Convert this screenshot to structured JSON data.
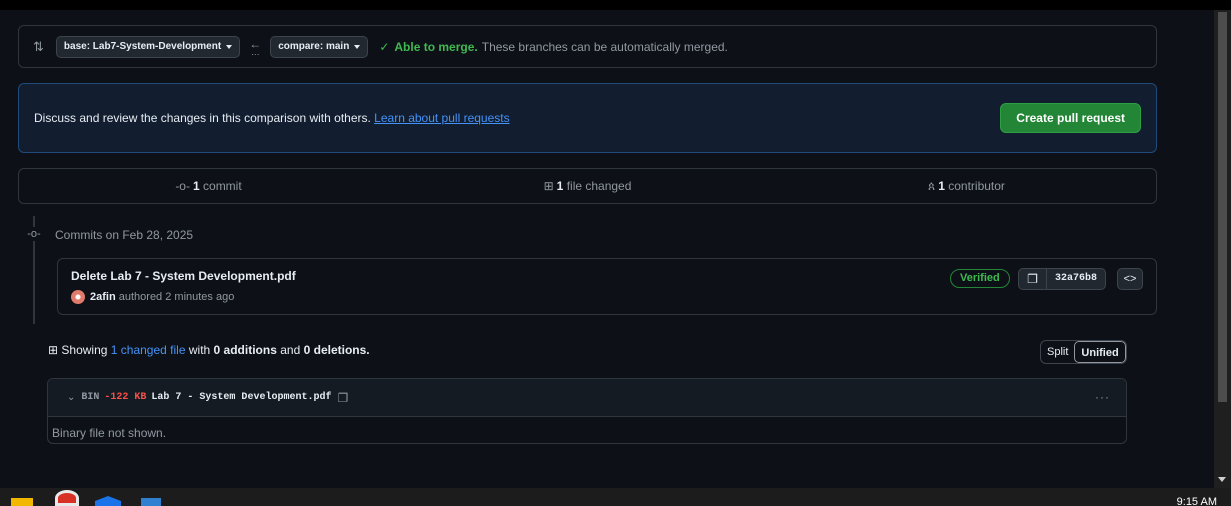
{
  "compare": {
    "base_label": "base: Lab7-System-Development",
    "compare_label": "compare: main",
    "merge_status": "Able to merge.",
    "merge_message": "These branches can be automatically merged."
  },
  "discuss": {
    "text": "Discuss and review the changes in this comparison with others.",
    "link": "Learn about pull requests",
    "button": "Create pull request"
  },
  "stats": {
    "commits_count": "1",
    "commits_label": "commit",
    "files_count": "1",
    "files_label": "file changed",
    "contributors_count": "1",
    "contributors_label": "contributor"
  },
  "timeline": {
    "date_label": "Commits on Feb 28, 2025"
  },
  "commit": {
    "title": "Delete Lab 7 - System Development.pdf",
    "author": "2afin",
    "meta": "authored 2 minutes ago",
    "badge": "Verified",
    "sha": "32a76b8"
  },
  "summary": {
    "prefix": "Showing",
    "changed_files": "1 changed file",
    "with": "with",
    "additions": "0 additions",
    "and": "and",
    "deletions": "0 deletions."
  },
  "view_toggle": {
    "split": "Split",
    "unified": "Unified",
    "selected": "Unified"
  },
  "file": {
    "type": "BIN",
    "size_change": "-122 KB",
    "name": "Lab 7 - System Development.pdf",
    "body": "Binary file not shown."
  },
  "taskbar": {
    "clock": "9:15 AM"
  },
  "colors": {
    "accent_green": "#238636",
    "link_blue": "#4493f8",
    "deletion_red": "#f85149",
    "background": "#0d1117"
  }
}
